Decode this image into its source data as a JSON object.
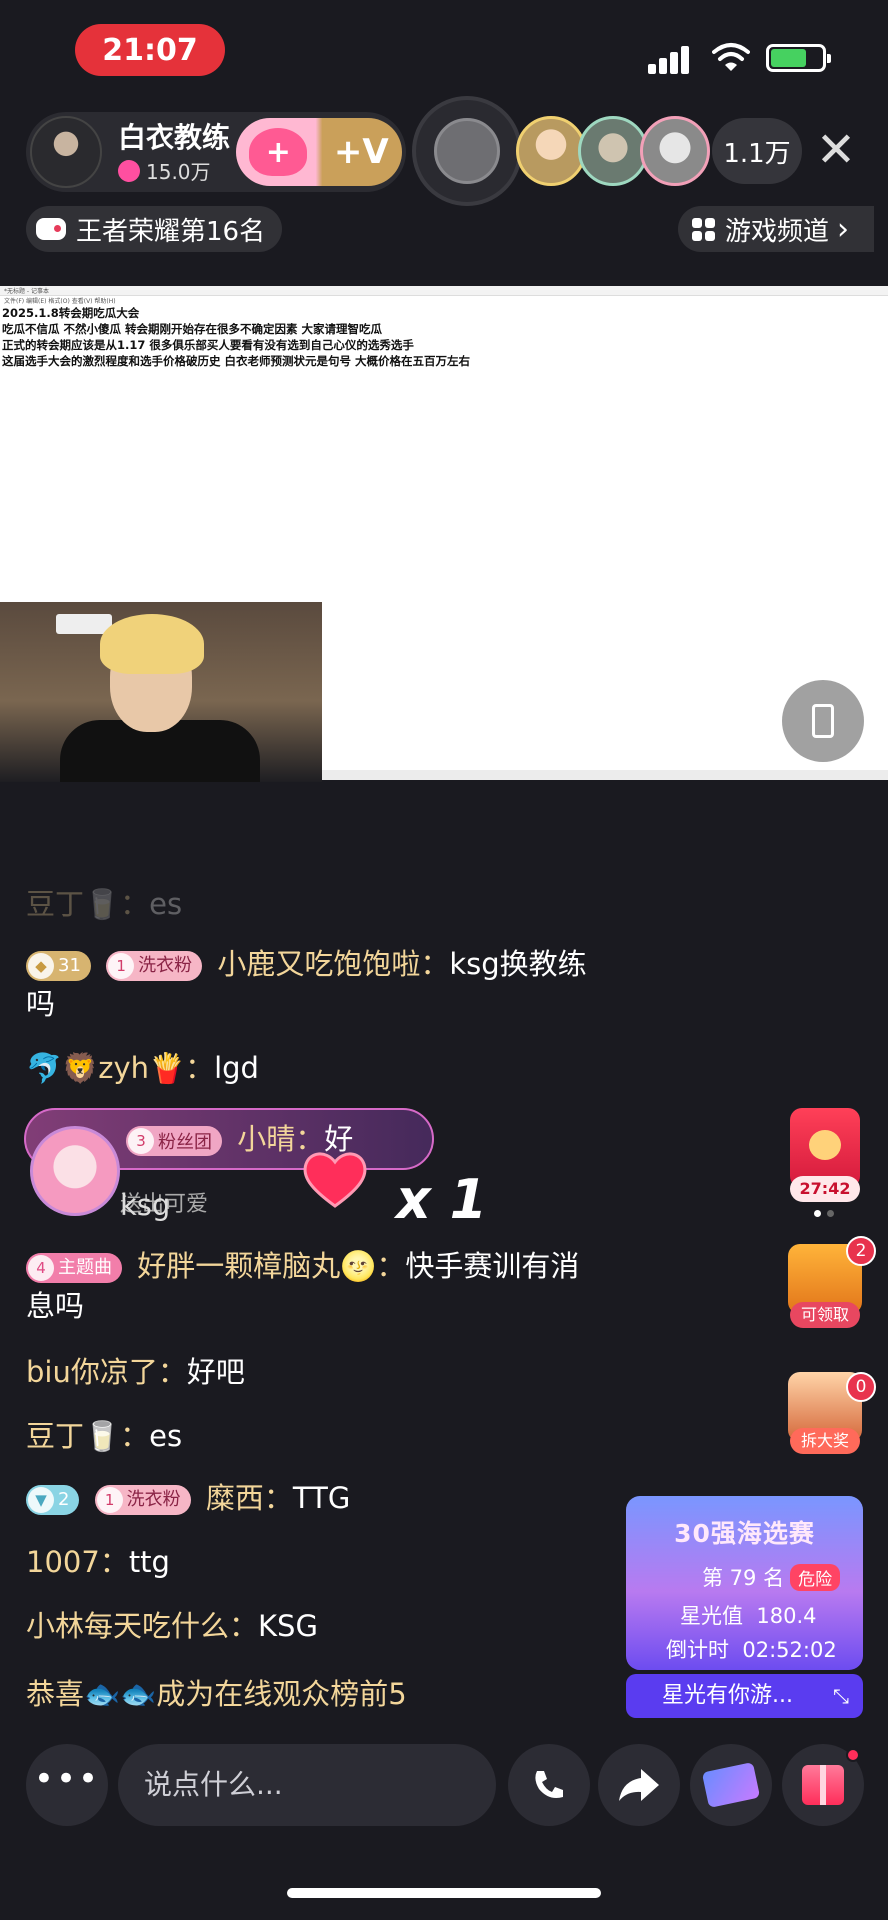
{
  "status": {
    "time": "21:07"
  },
  "host": {
    "name": "白衣教练",
    "heat": "15.0万",
    "follow_plus": "+",
    "follow_v": "+V"
  },
  "viewers": {
    "count": "1.1万"
  },
  "close_label": "✕",
  "rank": {
    "label": "王者荣耀第16名"
  },
  "channel": {
    "label": "游戏频道",
    "arrow": "›"
  },
  "stream": {
    "titlebar": "*无标题 - 记事本",
    "menubar": "文件(F)   编辑(E)   格式(O)   查看(V)   帮助(H)",
    "doc_lines": [
      "2025.1.8转会期吃瓜大会",
      "吃瓜不信瓜 不然小傻瓜  转会期刚开始存在很多不确定因素  大家请理智吃瓜",
      "正式的转会期应该是从1.17 很多俱乐部买人要看有没有选到自己心仪的选秀选手",
      "这届选手大会的激烈程度和选手价格破历史  白衣老师预测状元是句号 大概价格在五百万左右"
    ]
  },
  "chat": [
    {
      "name": "豆丁🥛：",
      "text": "es",
      "faded": true
    },
    {
      "level": "31",
      "fan_num": "1",
      "fan_label": "洗衣粉",
      "name": "小鹿又吃饱饱啦：",
      "text": "ksg换教练吗"
    },
    {
      "name": "🐬🦁zyh🍟：",
      "text": "lgd"
    },
    {
      "name": "biu你凉了：",
      "text": "好吧"
    },
    {
      "name": "豆丁🥛：",
      "text": "es"
    },
    {
      "level": "2",
      "fan_num": "1",
      "fan_label": "洗衣粉",
      "name": "糜西：",
      "text": "TTG"
    },
    {
      "name": "1007：",
      "text": "ttg"
    },
    {
      "name": "小林每天吃什么：",
      "text": "KSG"
    },
    {
      "name": "恭喜🐟🐟成为在线观众榜前5",
      "text": ""
    }
  ],
  "theme_msg": {
    "badge_num": "4",
    "badge_label": "主题曲",
    "name": "好胖一颗樟脑丸🌝：",
    "text": "快手赛训有消息吗"
  },
  "gift": {
    "fan_num": "3",
    "fan_label": "粉丝团",
    "name": "小晴：",
    "text": "好",
    "sub": "送出可爱",
    "count": "x 1",
    "behind_text": "ksg"
  },
  "side": {
    "redpacket_time": "27:42",
    "chest_count": "2",
    "chest_label": "可领取",
    "prize_count": "0",
    "prize_label": "拆大奖"
  },
  "contest": {
    "title": "30强海选赛",
    "rank": "第 79 名",
    "danger": "危险",
    "star_label": "星光值",
    "star_value": "180.4",
    "countdown_label": "倒计时",
    "countdown_value": "02:52:02",
    "bottom": "星光有你游...",
    "expand": "⤡"
  },
  "bottom": {
    "more": "•••",
    "placeholder": "说点什么..."
  },
  "colors": {
    "accent": "#e5323a",
    "name": "#f3d69a",
    "bg": "#1a1a20"
  }
}
